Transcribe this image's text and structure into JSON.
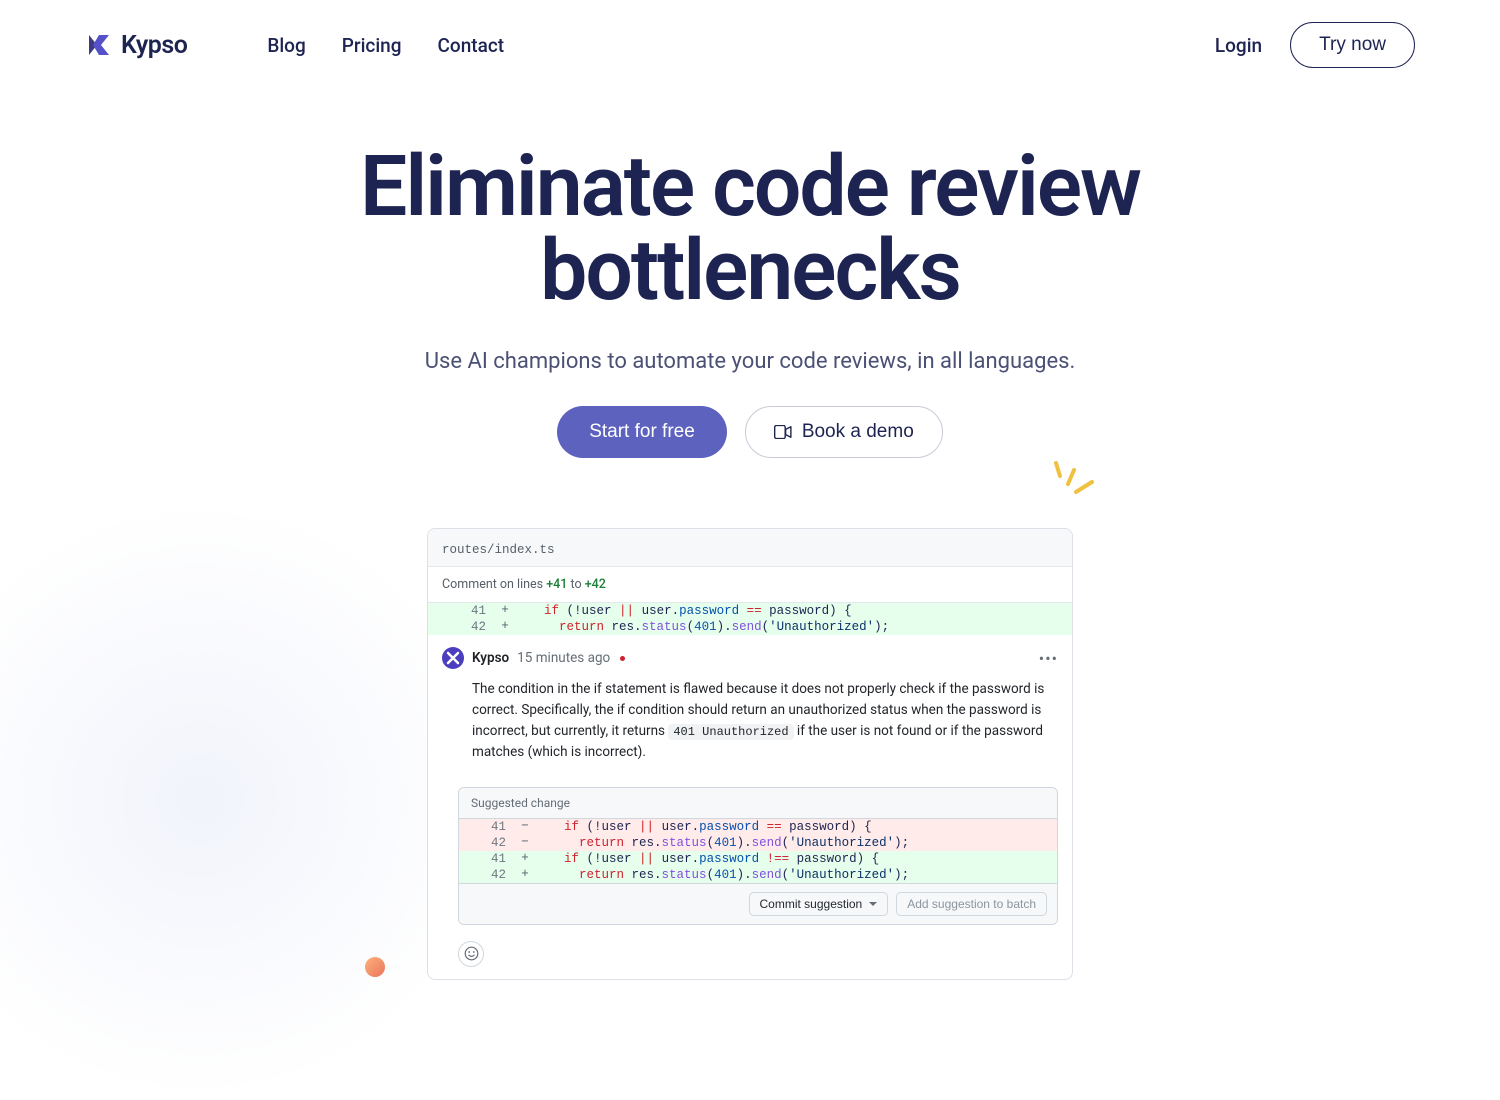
{
  "brand": "Kypso",
  "nav": {
    "blog": "Blog",
    "pricing": "Pricing",
    "contact": "Contact"
  },
  "auth": {
    "login": "Login",
    "try": "Try now"
  },
  "hero": {
    "headline": "Eliminate code review bottlenecks",
    "subhead": "Use AI champions to automate your code reviews, in all languages.",
    "start": "Start for free",
    "demo": "Book a demo"
  },
  "card": {
    "file": "routes/index.ts",
    "comment_lines_prefix": "Comment on lines ",
    "comment_from": "+41",
    "comment_to_word": " to ",
    "comment_to": "+42",
    "line41_no": "41",
    "line42_no": "42",
    "plus": "+",
    "minus": "−",
    "commenter": "Kypso",
    "time": "15 minutes ago",
    "text_before_chip": "The condition in the if statement is flawed because it does not properly check if the password is correct. Specifically, the if condition should return an unauthorized status when the password is incorrect, but currently, it returns ",
    "chip": "401 Unauthorized",
    "text_after_chip": " if the user is not found or if the password matches (which is incorrect).",
    "suggest_label": "Suggested change",
    "commit_btn": "Commit suggestion",
    "batch_btn": "Add suggestion to batch",
    "code_orig": {
      "l1_kw": "if",
      "l1_a": " (!user ",
      "l1_op": "||",
      "l1_b": " user.",
      "l1_prop": "password",
      "l1_eq": " == ",
      "l1_c": "password) {",
      "l2_kw": "return",
      "l2_a": " res.",
      "l2_fn": "status",
      "l2_p1": "(",
      "l2_num": "401",
      "l2_p2": ").",
      "l2_fn2": "send",
      "l2_p3": "(",
      "l2_str": "'Unauthorized'",
      "l2_p4": ");"
    },
    "code_fix": {
      "l1_kw": "if",
      "l1_a": " (!user ",
      "l1_op": "||",
      "l1_b": " user.",
      "l1_prop": "password",
      "l1_neq": " !== ",
      "l1_c": "password) {"
    }
  }
}
